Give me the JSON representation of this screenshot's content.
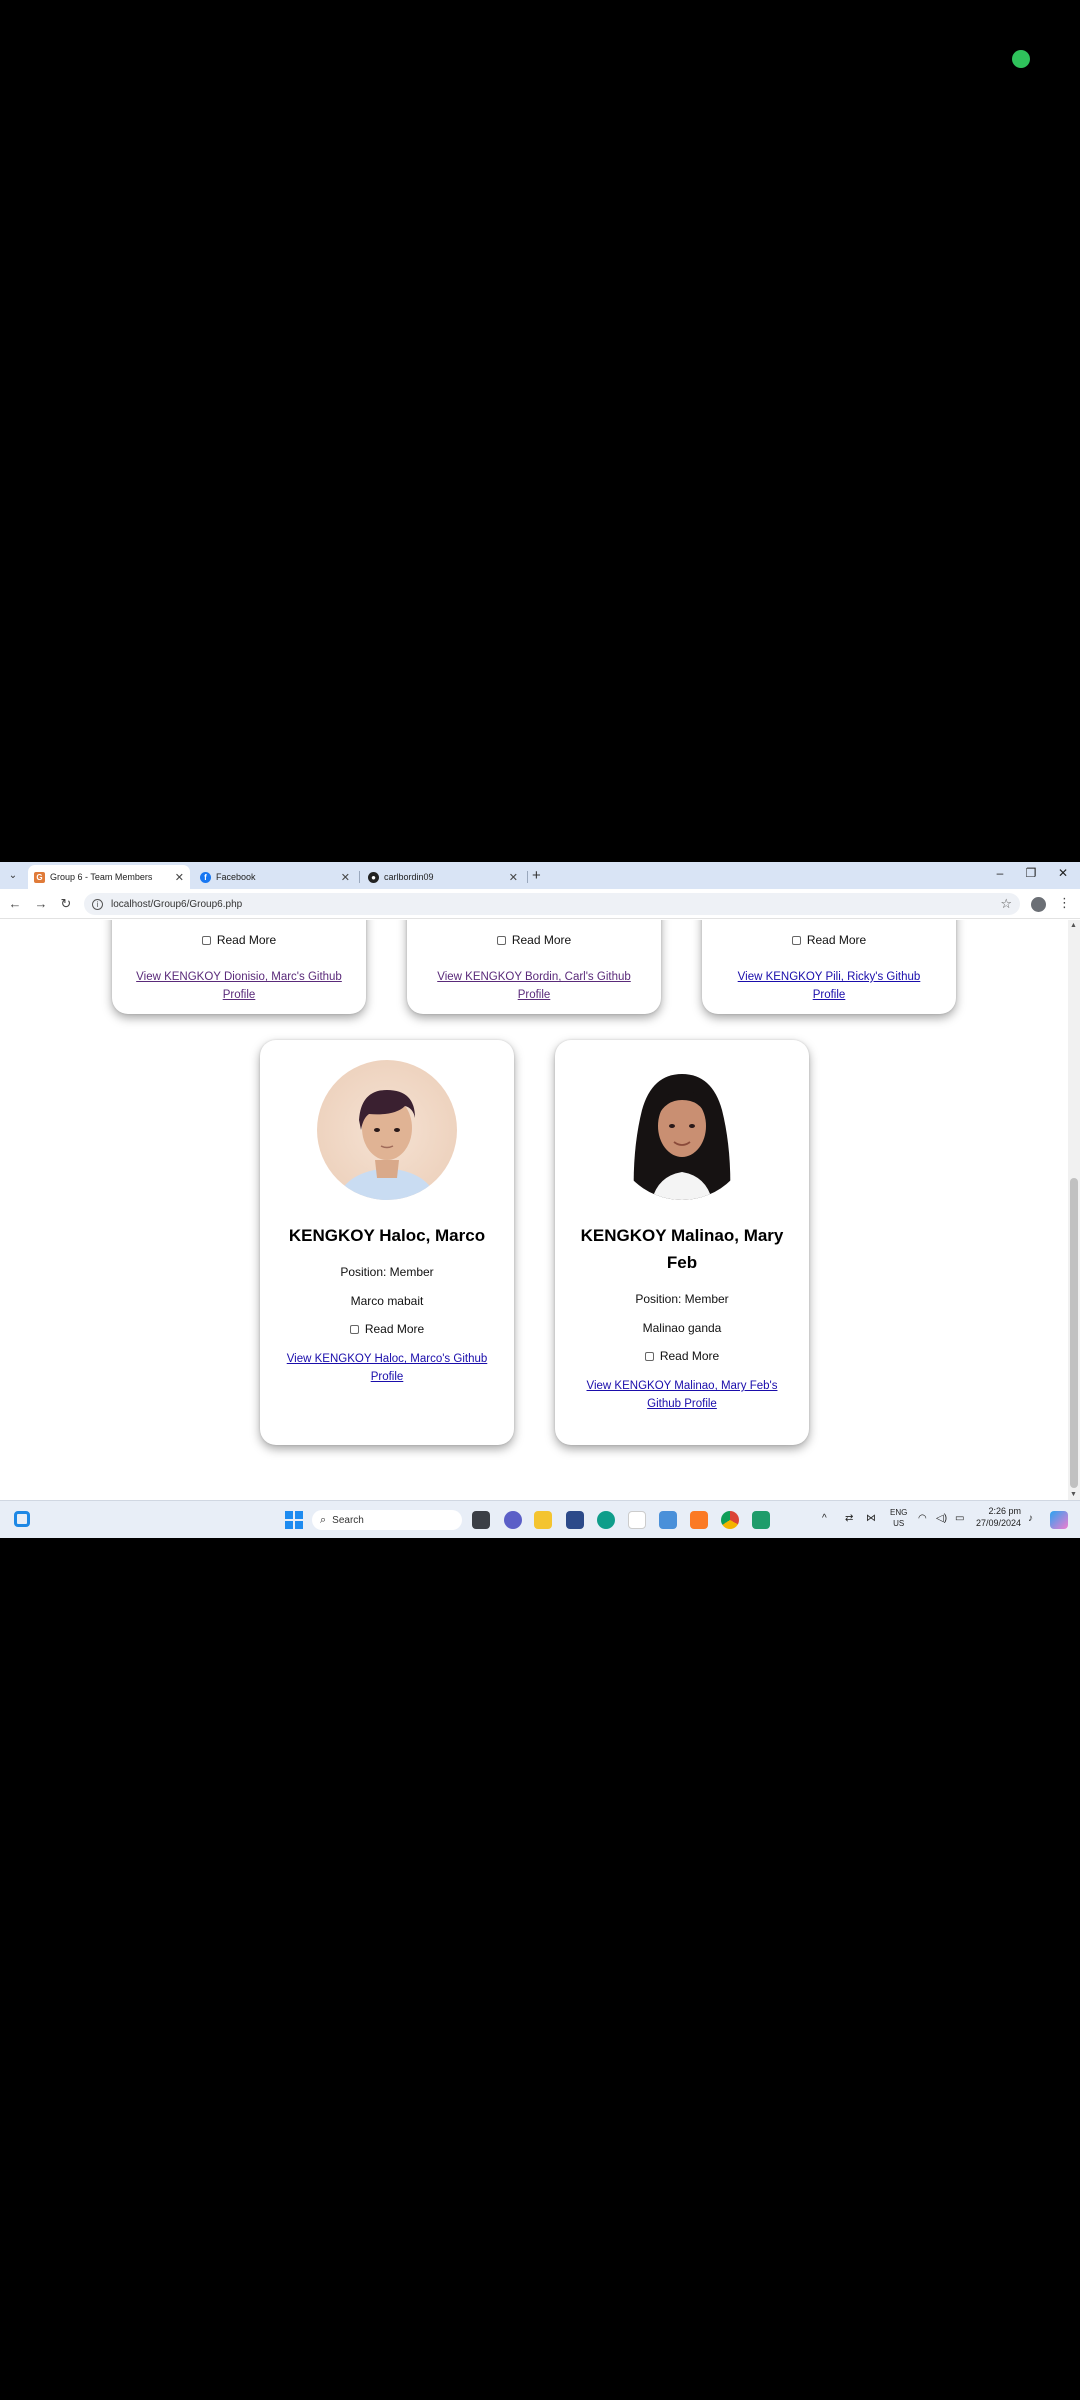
{
  "browser": {
    "tabs": [
      {
        "title": "Group 6 - Team Members",
        "active": true,
        "favicon": "site-icon"
      },
      {
        "title": "Facebook",
        "active": false,
        "favicon": "facebook-icon"
      },
      {
        "title": "carlbordin09",
        "active": false,
        "favicon": "github-icon"
      }
    ],
    "address": "localhost/Group6/Group6.php"
  },
  "top_cards": [
    {
      "read_more": "Read More",
      "link": "View KENGKOY Dionisio, Marc's Github Profile",
      "visited": true
    },
    {
      "read_more": "Read More",
      "link": "View KENGKOY Bordin, Carl's Github Profile",
      "visited": true
    },
    {
      "read_more": "Read More",
      "link": "View KENGKOY Pili, Ricky's Github Profile",
      "visited": false
    }
  ],
  "cards": [
    {
      "name": "KENGKOY Haloc, Marco",
      "position": "Position: Member",
      "desc": "Marco mabait",
      "read_more": "Read More",
      "link": "View KENGKOY Haloc, Marco's Github Profile"
    },
    {
      "name": "KENGKOY Malinao, Mary Feb",
      "position": "Position: Member",
      "desc": "Malinao ganda",
      "read_more": "Read More",
      "link": "View KENGKOY Malinao, Mary Feb's Github Profile"
    }
  ],
  "taskbar": {
    "search_placeholder": "Search",
    "lang_top": "ENG",
    "lang_bottom": "US",
    "time": "2:26 pm",
    "date": "27/09/2024"
  },
  "colors": {
    "link": "#1a0dab",
    "visited_link": "#5a2a7a",
    "tabstrip": "#d9e4f5",
    "recording_dot": "#2fc25b"
  }
}
